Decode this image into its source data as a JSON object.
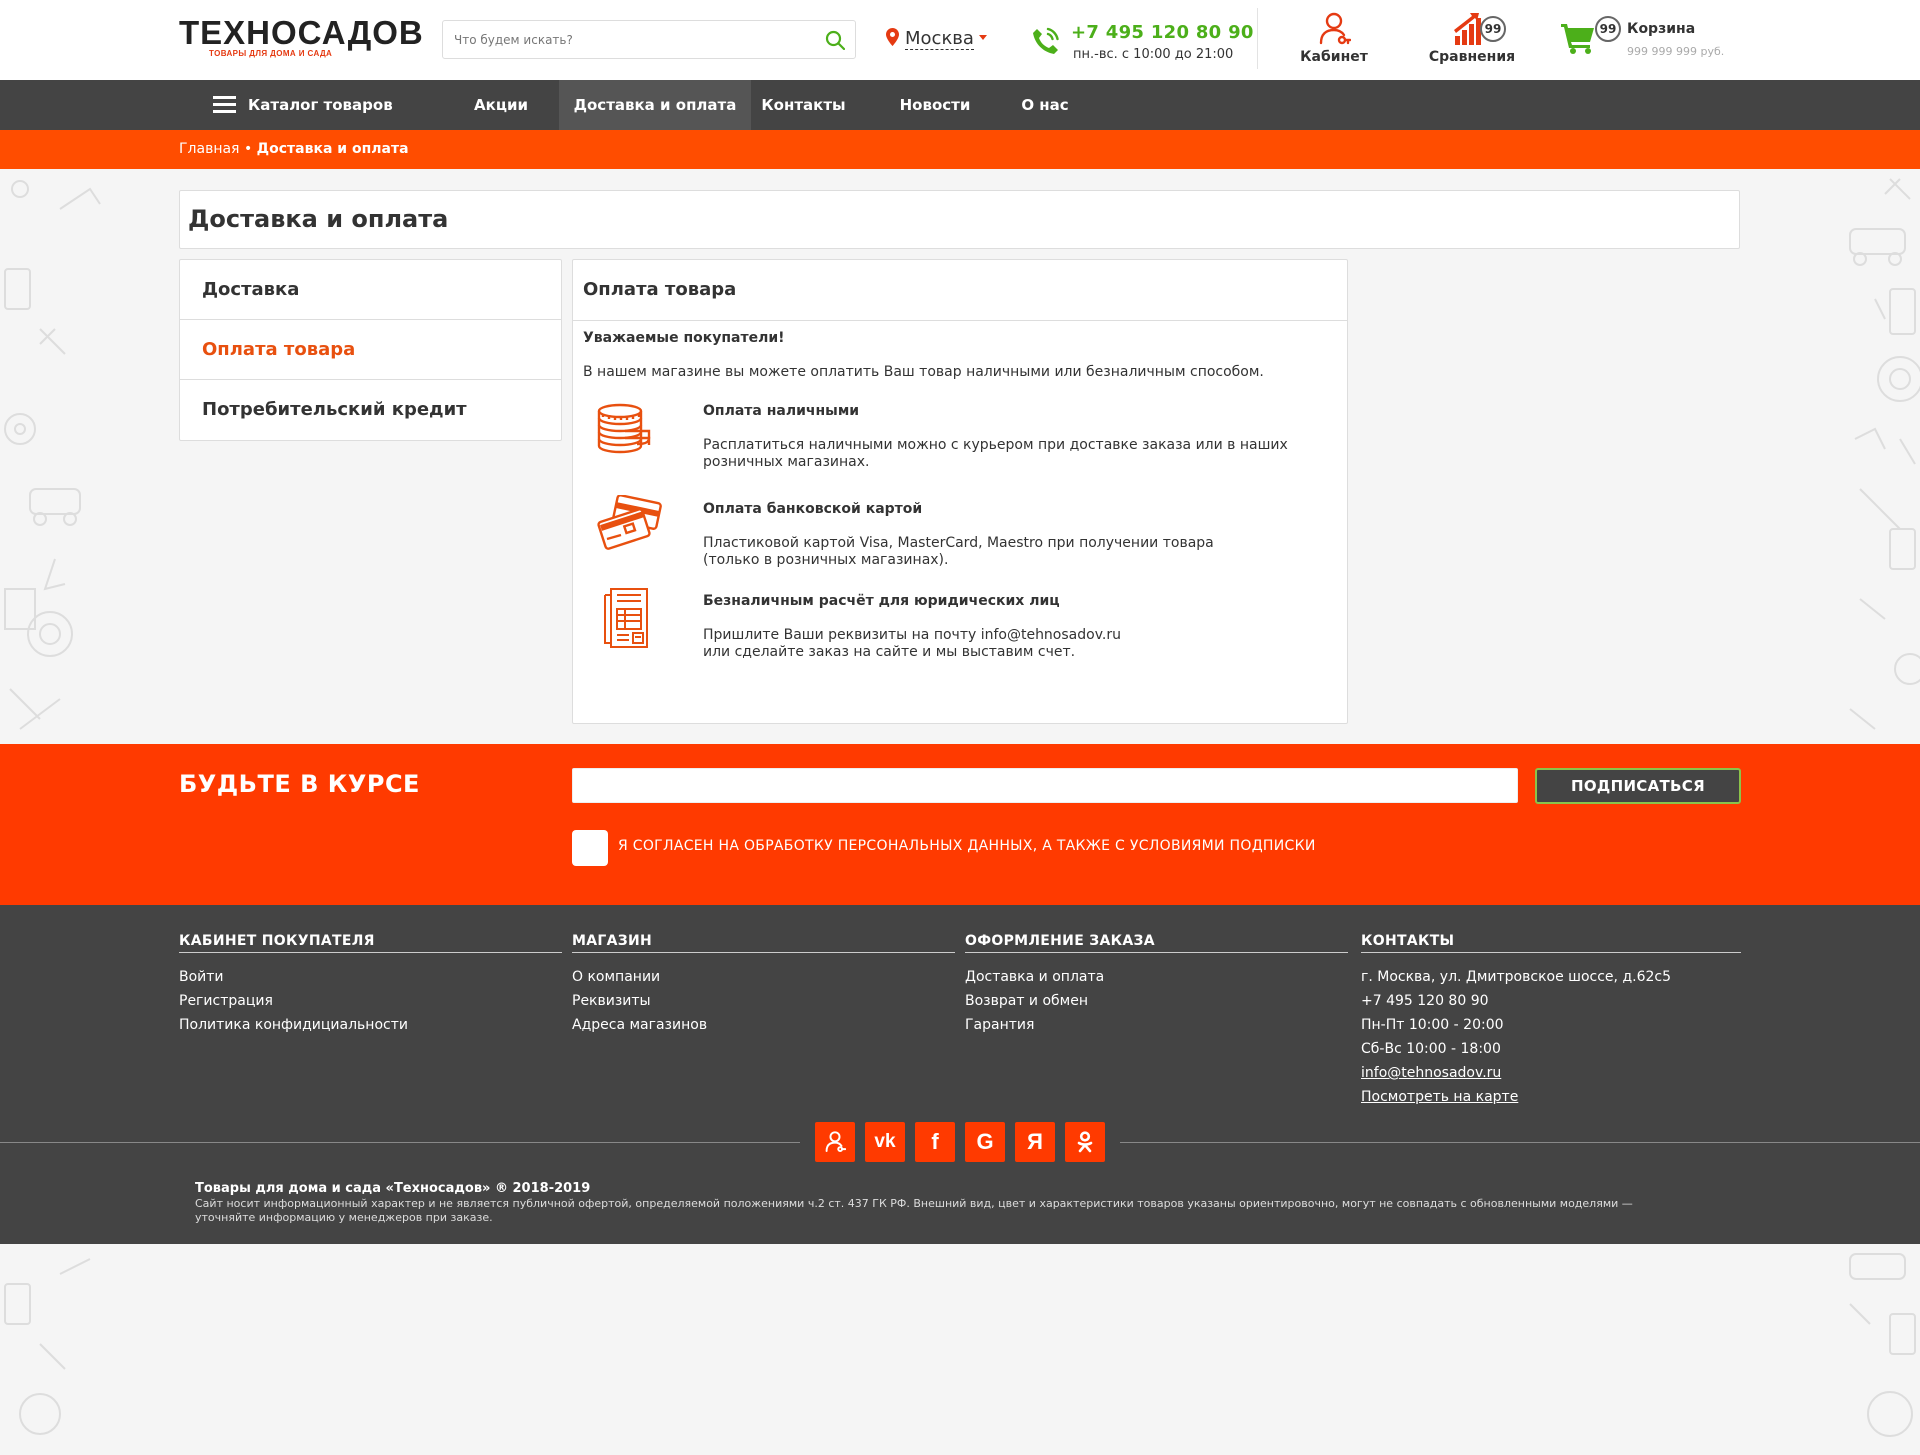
{
  "header": {
    "logo_main": "ТЕХНОСАДОВ",
    "logo_sub": "ТОВАРЫ ДЛЯ ДОМА И САДА",
    "search_placeholder": "Что будем искать?",
    "city": "Москва",
    "phone": "+7 495 120 80 90",
    "hours": "пн.-вс. с 10:00 до 21:00",
    "cabinet_label": "Кабинет",
    "compare_label": "Сравнения",
    "compare_count": "99",
    "cart_label": "Корзина",
    "cart_count": "99",
    "cart_sum": "999 999 999 руб.",
    "accent_color": "#ff4d00",
    "phone_color": "#4caf1a"
  },
  "nav": {
    "catalog": "Каталог товаров",
    "items": [
      "Акции",
      "Доставка и оплата",
      "Контакты",
      "Новости",
      "О нас"
    ],
    "active": "Доставка и оплата"
  },
  "breadcrumb": {
    "home": "Главная",
    "separator": "•",
    "current": "Доставка и оплата"
  },
  "page": {
    "title": "Доставка и оплата",
    "side_menu": [
      "Доставка",
      "Оплата товара",
      "Потребительский кредит"
    ],
    "side_active": "Оплата товара",
    "panel_title": "Оплата товара",
    "greeting": "Уважаемые покупатели!",
    "intro": "В нашем магазине вы можете оплатить Ваш товар наличными или безналичным способом.",
    "methods": [
      {
        "icon": "coins-icon",
        "title": "Оплата наличными",
        "text": "Расплатиться наличными можно с курьером при доставке заказа или в наших розничных магазинах."
      },
      {
        "icon": "credit-card-icon",
        "title": "Оплата банковской картой",
        "text_line1": "Пластиковой картой Visa, MasterCard, Maestro при получении товара",
        "text_line2": "(только в розничных магазинах)."
      },
      {
        "icon": "invoice-icon",
        "title": "Безналичным расчёт для юридических лиц",
        "text_line1": "Пришлите Ваши реквизиты на почту  info@tehnosadov.ru",
        "text_line2": "или сделайте заказ на сайте и мы выставим счет."
      }
    ]
  },
  "subscribe": {
    "title": "БУДЬТЕ В КУРСЕ",
    "button": "ПОДПИСАТЬСЯ",
    "agree": "Я СОГЛАСЕН НА ОБРАБОТКУ ПЕРСОНАЛЬНЫХ ДАННЫХ, А ТАКЖЕ С УСЛОВИЯМИ ПОДПИСКИ"
  },
  "footer": {
    "columns": [
      {
        "title": "КАБИНЕТ ПОКУПАТЕЛЯ",
        "links": [
          "Войти",
          "Регистрация",
          "Политика конфидициальности"
        ]
      },
      {
        "title": "МАГАЗИН",
        "links": [
          "О компании",
          "Реквизиты",
          "Адреса магазинов"
        ]
      },
      {
        "title": "ОФОРМЛЕНИЕ ЗАКАЗА",
        "links": [
          "Доставка и оплата",
          "Возврат и обмен",
          "Гарантия"
        ]
      },
      {
        "title": "КОНТАКТЫ",
        "links": [
          "г. Москва, ул. Дмитровское шоссе, д.62с5",
          "+7 495 120 80 90",
          "Пн-Пт 10:00 - 20:00",
          "Сб-Вс 10:00 - 18:00",
          "info@tehnosadov.ru",
          "Посмотреть на карте"
        ]
      }
    ],
    "socials": [
      "user-icon",
      "vk-icon",
      "facebook-icon",
      "google-icon",
      "yandex-icon",
      "odnoklassniki-icon"
    ],
    "social_letters": {
      "vk": "vk",
      "facebook": "f",
      "google": "G",
      "yandex": "Я"
    },
    "copyright_title": "Товары для дома и сада «Техносадов» ® 2018-2019",
    "copyright_text": "Сайт носит информационный характер и не является публичной офертой, определяемой положениями ч.2 ст. 437 ГК РФ. Внешний вид, цвет и характеристики товаров указаны ориентировочно, могут не совпадать с обновленными моделями — уточняйте информацию у менеджеров при заказе."
  }
}
